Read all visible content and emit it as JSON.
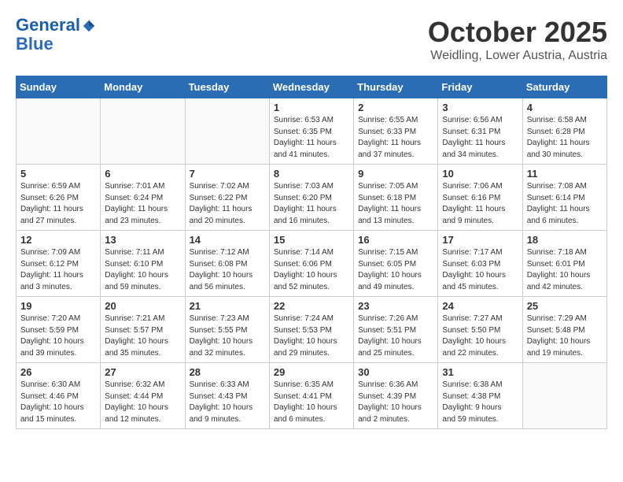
{
  "header": {
    "logo_line1": "General",
    "logo_line2": "Blue",
    "month": "October 2025",
    "location": "Weidling, Lower Austria, Austria"
  },
  "weekdays": [
    "Sunday",
    "Monday",
    "Tuesday",
    "Wednesday",
    "Thursday",
    "Friday",
    "Saturday"
  ],
  "weeks": [
    [
      {
        "day": "",
        "info": ""
      },
      {
        "day": "",
        "info": ""
      },
      {
        "day": "",
        "info": ""
      },
      {
        "day": "1",
        "info": "Sunrise: 6:53 AM\nSunset: 6:35 PM\nDaylight: 11 hours\nand 41 minutes."
      },
      {
        "day": "2",
        "info": "Sunrise: 6:55 AM\nSunset: 6:33 PM\nDaylight: 11 hours\nand 37 minutes."
      },
      {
        "day": "3",
        "info": "Sunrise: 6:56 AM\nSunset: 6:31 PM\nDaylight: 11 hours\nand 34 minutes."
      },
      {
        "day": "4",
        "info": "Sunrise: 6:58 AM\nSunset: 6:28 PM\nDaylight: 11 hours\nand 30 minutes."
      }
    ],
    [
      {
        "day": "5",
        "info": "Sunrise: 6:59 AM\nSunset: 6:26 PM\nDaylight: 11 hours\nand 27 minutes."
      },
      {
        "day": "6",
        "info": "Sunrise: 7:01 AM\nSunset: 6:24 PM\nDaylight: 11 hours\nand 23 minutes."
      },
      {
        "day": "7",
        "info": "Sunrise: 7:02 AM\nSunset: 6:22 PM\nDaylight: 11 hours\nand 20 minutes."
      },
      {
        "day": "8",
        "info": "Sunrise: 7:03 AM\nSunset: 6:20 PM\nDaylight: 11 hours\nand 16 minutes."
      },
      {
        "day": "9",
        "info": "Sunrise: 7:05 AM\nSunset: 6:18 PM\nDaylight: 11 hours\nand 13 minutes."
      },
      {
        "day": "10",
        "info": "Sunrise: 7:06 AM\nSunset: 6:16 PM\nDaylight: 11 hours\nand 9 minutes."
      },
      {
        "day": "11",
        "info": "Sunrise: 7:08 AM\nSunset: 6:14 PM\nDaylight: 11 hours\nand 6 minutes."
      }
    ],
    [
      {
        "day": "12",
        "info": "Sunrise: 7:09 AM\nSunset: 6:12 PM\nDaylight: 11 hours\nand 3 minutes."
      },
      {
        "day": "13",
        "info": "Sunrise: 7:11 AM\nSunset: 6:10 PM\nDaylight: 10 hours\nand 59 minutes."
      },
      {
        "day": "14",
        "info": "Sunrise: 7:12 AM\nSunset: 6:08 PM\nDaylight: 10 hours\nand 56 minutes."
      },
      {
        "day": "15",
        "info": "Sunrise: 7:14 AM\nSunset: 6:06 PM\nDaylight: 10 hours\nand 52 minutes."
      },
      {
        "day": "16",
        "info": "Sunrise: 7:15 AM\nSunset: 6:05 PM\nDaylight: 10 hours\nand 49 minutes."
      },
      {
        "day": "17",
        "info": "Sunrise: 7:17 AM\nSunset: 6:03 PM\nDaylight: 10 hours\nand 45 minutes."
      },
      {
        "day": "18",
        "info": "Sunrise: 7:18 AM\nSunset: 6:01 PM\nDaylight: 10 hours\nand 42 minutes."
      }
    ],
    [
      {
        "day": "19",
        "info": "Sunrise: 7:20 AM\nSunset: 5:59 PM\nDaylight: 10 hours\nand 39 minutes."
      },
      {
        "day": "20",
        "info": "Sunrise: 7:21 AM\nSunset: 5:57 PM\nDaylight: 10 hours\nand 35 minutes."
      },
      {
        "day": "21",
        "info": "Sunrise: 7:23 AM\nSunset: 5:55 PM\nDaylight: 10 hours\nand 32 minutes."
      },
      {
        "day": "22",
        "info": "Sunrise: 7:24 AM\nSunset: 5:53 PM\nDaylight: 10 hours\nand 29 minutes."
      },
      {
        "day": "23",
        "info": "Sunrise: 7:26 AM\nSunset: 5:51 PM\nDaylight: 10 hours\nand 25 minutes."
      },
      {
        "day": "24",
        "info": "Sunrise: 7:27 AM\nSunset: 5:50 PM\nDaylight: 10 hours\nand 22 minutes."
      },
      {
        "day": "25",
        "info": "Sunrise: 7:29 AM\nSunset: 5:48 PM\nDaylight: 10 hours\nand 19 minutes."
      }
    ],
    [
      {
        "day": "26",
        "info": "Sunrise: 6:30 AM\nSunset: 4:46 PM\nDaylight: 10 hours\nand 15 minutes."
      },
      {
        "day": "27",
        "info": "Sunrise: 6:32 AM\nSunset: 4:44 PM\nDaylight: 10 hours\nand 12 minutes."
      },
      {
        "day": "28",
        "info": "Sunrise: 6:33 AM\nSunset: 4:43 PM\nDaylight: 10 hours\nand 9 minutes."
      },
      {
        "day": "29",
        "info": "Sunrise: 6:35 AM\nSunset: 4:41 PM\nDaylight: 10 hours\nand 6 minutes."
      },
      {
        "day": "30",
        "info": "Sunrise: 6:36 AM\nSunset: 4:39 PM\nDaylight: 10 hours\nand 2 minutes."
      },
      {
        "day": "31",
        "info": "Sunrise: 6:38 AM\nSunset: 4:38 PM\nDaylight: 9 hours\nand 59 minutes."
      },
      {
        "day": "",
        "info": ""
      }
    ]
  ]
}
